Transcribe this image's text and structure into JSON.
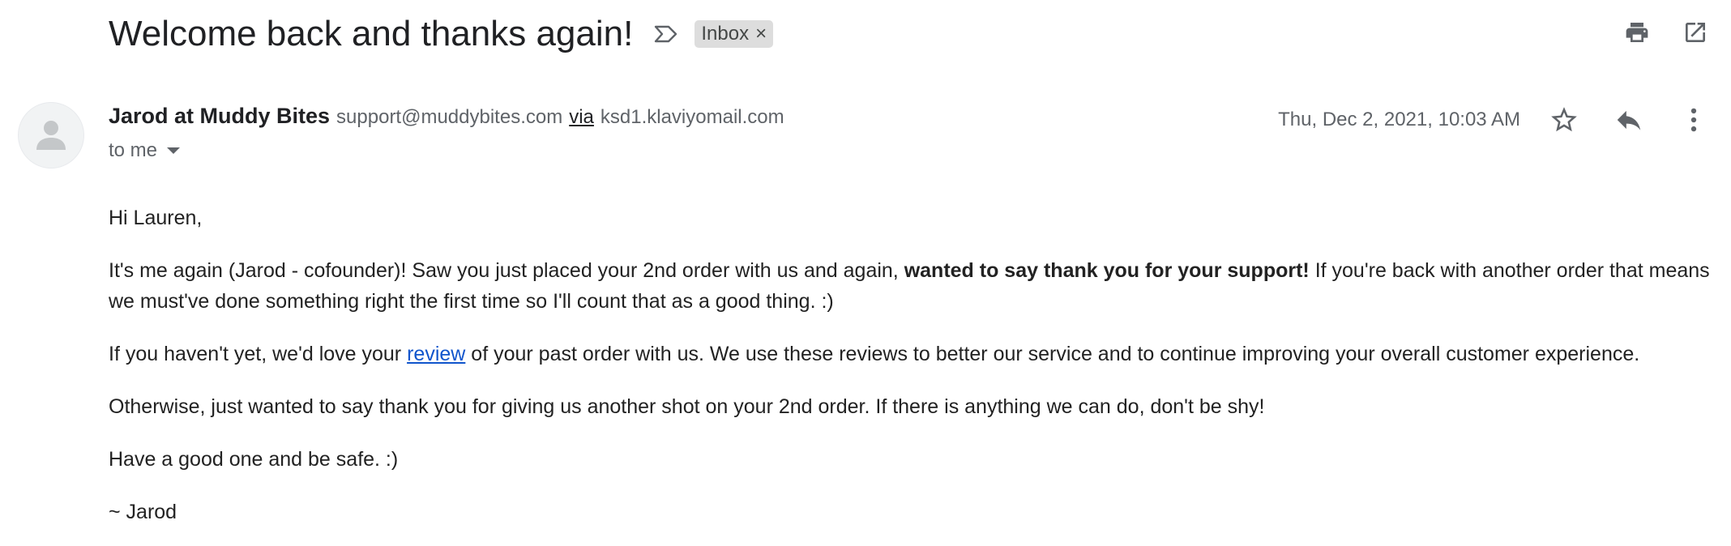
{
  "email": {
    "subject": "Welcome back and thanks again!",
    "label_chip": "Inbox",
    "label_chip_remove": "×",
    "sender": {
      "name": "Jarod at Muddy Bites",
      "email": "support@muddybites.com",
      "via_label": "via",
      "via_domain": "ksd1.klaviyomail.com"
    },
    "recipient_line": "to me",
    "date": "Thu, Dec 2, 2021, 10:03 AM",
    "body": {
      "greeting": "Hi Lauren,",
      "p1_start": "It's me again (Jarod - cofounder)! Saw you just placed your 2nd order with us and again, ",
      "p1_bold": "wanted to say thank you for your support!",
      "p1_end": " If you're back with another order that means we must've done something right the first time so I'll count that as a good thing. :)",
      "p2_start": "If you haven't yet, we'd love your ",
      "p2_link": "review",
      "p2_end": " of your past order with us. We use these reviews to better our service and to continue improving your overall customer experience.",
      "p3": "Otherwise, just wanted to say thank you for giving us another shot on your 2nd order. If there is anything we can do, don't be shy!",
      "p4": "Have a good one and be safe. :)",
      "signature": "~ Jarod"
    }
  },
  "icons": {
    "label": "label-outline-icon",
    "print": "print-icon",
    "open_new_window": "open-in-new-icon",
    "avatar": "person-icon",
    "star": "star-outline-icon",
    "reply": "reply-icon",
    "more": "more-vert-icon"
  },
  "colors": {
    "link": "#1155cc",
    "chip_bg": "#dddddd",
    "icon": "#5f6368",
    "text": "#202124"
  }
}
